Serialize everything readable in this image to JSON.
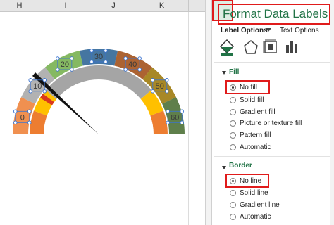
{
  "sheet": {
    "columns": [
      "H",
      "I",
      "J",
      "K"
    ],
    "gauge_labels": [
      "0",
      "10",
      "20",
      "30",
      "40",
      "50",
      "60"
    ],
    "colors": {
      "orange": "#ed7d31",
      "yellow": "#ffc000",
      "gray": "#a5a5a5",
      "blue": "#4472c4",
      "green": "#70ad47",
      "darkblue": "#255e91",
      "brown": "#9e480e",
      "olive": "#997300",
      "pink": "#f4b7b0",
      "darkgreen": "#43682b",
      "selection": "#3a73d1"
    }
  },
  "pane": {
    "title": "Format Data Labels",
    "tab_label_options": "Label Options",
    "tab_text_options": "Text Options",
    "icons": [
      "fill-line-icon",
      "effects-icon",
      "size-properties-icon",
      "label-options-icon"
    ],
    "fill": {
      "heading": "Fill",
      "options": [
        {
          "label": "No fill",
          "checked": true
        },
        {
          "label": "Solid fill",
          "checked": false
        },
        {
          "label": "Gradient fill",
          "checked": false
        },
        {
          "label": "Picture or texture fill",
          "checked": false
        },
        {
          "label": "Pattern fill",
          "checked": false
        },
        {
          "label": "Automatic",
          "checked": false
        }
      ]
    },
    "border": {
      "heading": "Border",
      "options": [
        {
          "label": "No line",
          "checked": true
        },
        {
          "label": "Solid line",
          "checked": false
        },
        {
          "label": "Gradient line",
          "checked": false
        },
        {
          "label": "Automatic",
          "checked": false
        }
      ]
    },
    "accent_color": "#217346",
    "highlight_color": "#e01b1b"
  }
}
